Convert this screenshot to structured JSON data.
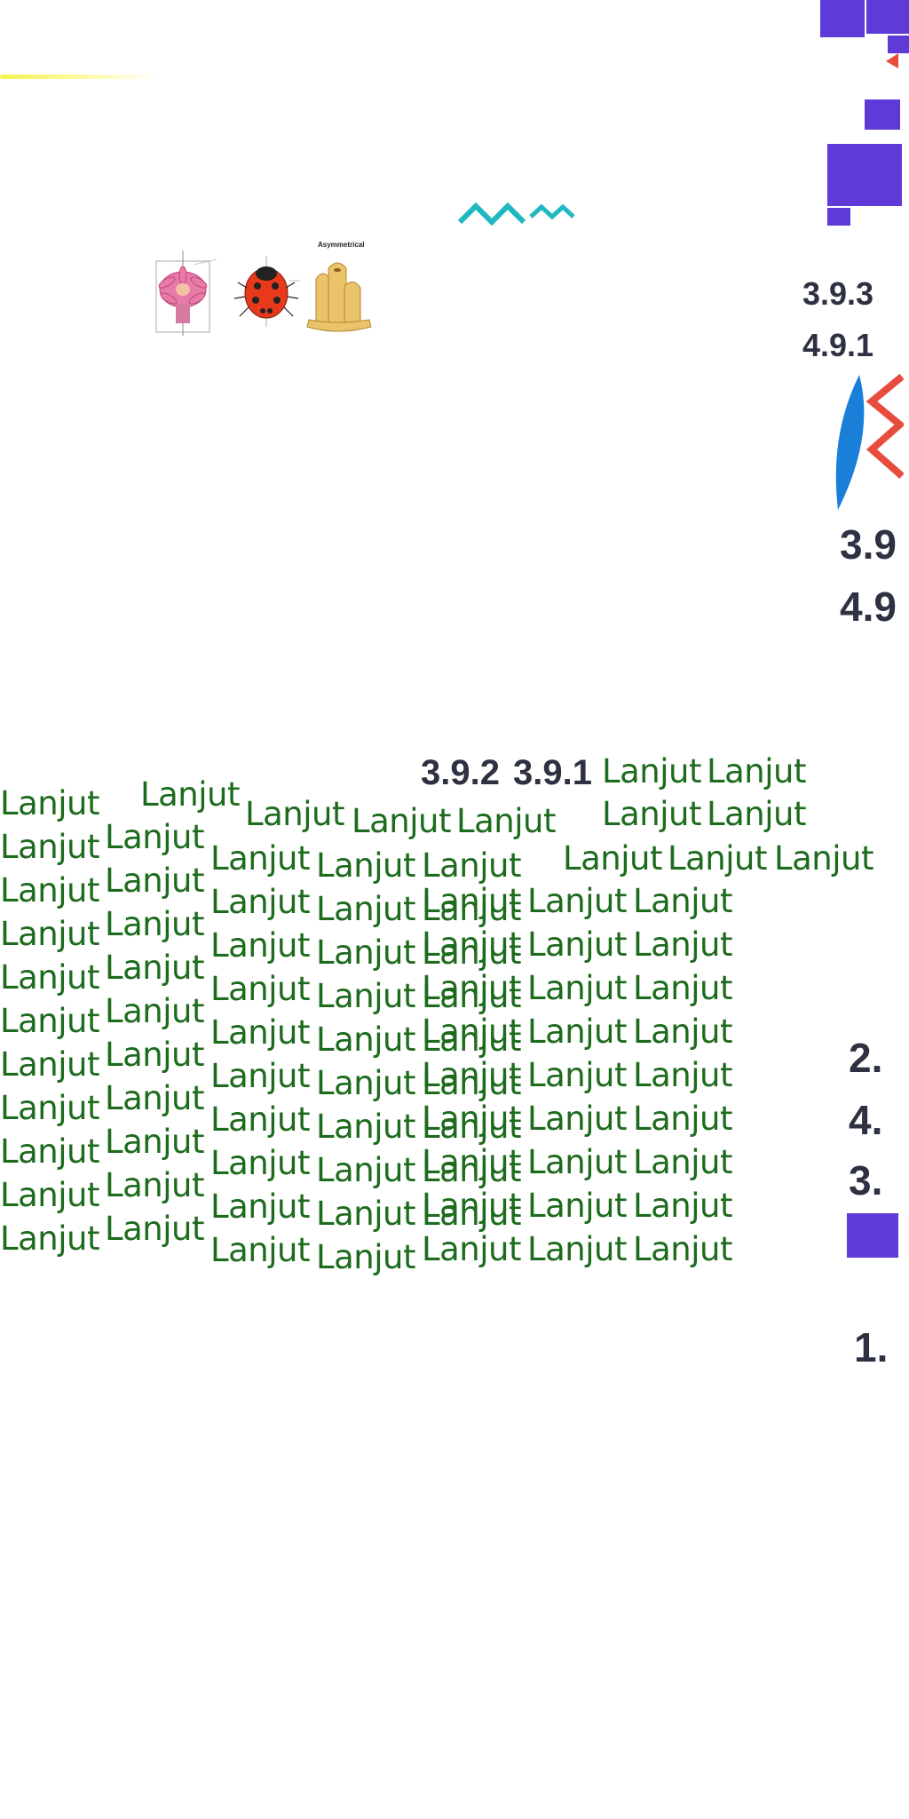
{
  "decor": {
    "accent_purple": "#5e3ad8",
    "accent_teal": "#1fb8c0",
    "accent_red": "#e84c3d",
    "accent_blue": "#1a7fd8",
    "text_green": "#1d6b1d"
  },
  "diagram": {
    "panel3_label": "Asymmetrical"
  },
  "codes": {
    "top_1": "3.9.3",
    "top_2": "4.9.1",
    "mid_1": "3.9",
    "mid_2": "4.9",
    "row_1": "3.9.2",
    "row_2": "3.9.1",
    "side_1": "2.",
    "side_2": "4.",
    "side_3": "3.",
    "side_4": "1."
  },
  "continue_label": "Lanjut"
}
